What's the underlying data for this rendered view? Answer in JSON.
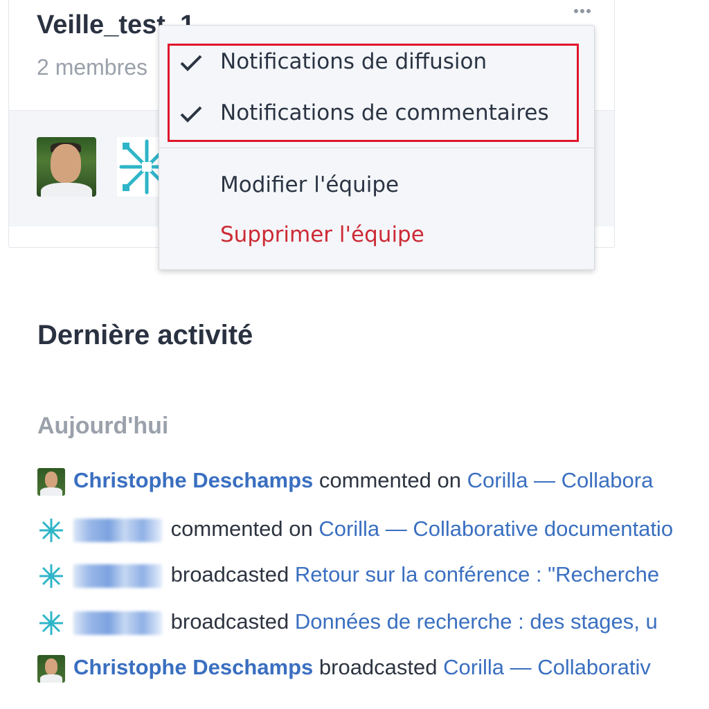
{
  "team_card": {
    "title": "Veille_test_1",
    "members": "2 membres",
    "more_icon": "more-horizontal-icon"
  },
  "menu": {
    "items": [
      {
        "label": "Notifications de diffusion",
        "checked": true
      },
      {
        "label": "Notifications de commentaires",
        "checked": true
      },
      {
        "label": "Modifier l'équipe",
        "checked": false
      },
      {
        "label": "Supprimer l'équipe",
        "checked": false
      }
    ],
    "highlight_color": "#e0152b",
    "danger_color": "#cc2a35"
  },
  "activity": {
    "title": "Dernière activité",
    "day": "Aujourd'hui",
    "rows": [
      {
        "user": "Christophe Deschamps",
        "user_visible": true,
        "avatar": "photo",
        "verb": "commented on",
        "link": "Corilla — Collabora"
      },
      {
        "user": "",
        "user_visible": false,
        "avatar": "pattern",
        "verb": "commented on",
        "link": "Corilla — Collaborative documentatio"
      },
      {
        "user": "",
        "user_visible": false,
        "avatar": "pattern",
        "verb": "broadcasted",
        "link": "Retour sur la conférence : \"Recherche"
      },
      {
        "user": "",
        "user_visible": false,
        "avatar": "pattern",
        "verb": "broadcasted",
        "link": "Données de recherche : des stages, u"
      },
      {
        "user": "Christophe Deschamps",
        "user_visible": true,
        "avatar": "photo",
        "verb": "broadcasted",
        "link": "Corilla — Collaborativ"
      }
    ]
  },
  "colors": {
    "link": "#3a6fc0",
    "title": "#2a3241",
    "muted": "#9aa1ab"
  }
}
